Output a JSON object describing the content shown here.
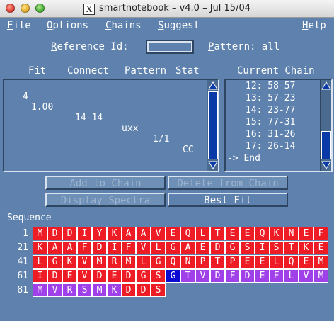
{
  "window": {
    "title": "smartnotebook – v4.0 – Jul 15/04",
    "x_glyph": "X"
  },
  "menus": [
    {
      "pre": "",
      "u": "F",
      "post": "ile"
    },
    {
      "pre": "",
      "u": "O",
      "post": "ptions"
    },
    {
      "pre": "",
      "u": "C",
      "post": "hains"
    },
    {
      "pre": "",
      "u": "S",
      "post": "uggest"
    },
    {
      "pre": "",
      "u": "H",
      "post": "elp"
    }
  ],
  "reference": {
    "label_u": "R",
    "label_rest": "eference Id:",
    "value": ""
  },
  "pattern": {
    "label_u": "P",
    "label_rest": "attern: all"
  },
  "fit_table": {
    "headers": [
      "Fit",
      "Connect",
      "Pattern",
      "Stat"
    ],
    "rows": [
      {
        "n": "4",
        "fit": "1.00",
        "connect": "14-14",
        "pattern": "uxx",
        "stat": "1/1",
        "extra": "CC"
      }
    ]
  },
  "chain": {
    "header": "Current Chain",
    "items": [
      "12: 58-57",
      "13: 57-23",
      "14: 23-77",
      "15: 77-31",
      "16: 31-26",
      "17: 26-14",
      "-> End"
    ]
  },
  "buttons": {
    "add_to_chain": "Add to Chain",
    "delete_from_chain": "Delete from Chain",
    "display_spectra": "Display Spectra",
    "best_fit": "Best Fit"
  },
  "sequence": {
    "label": "Sequence",
    "colors": {
      "red": "#ee1c24",
      "blue": "#0a0ad0",
      "purple": "#a040e8"
    },
    "rows": [
      {
        "start": "1",
        "residues": [
          "M",
          "D",
          "D",
          "I",
          "Y",
          "K",
          "A",
          "A",
          "V",
          "E",
          "Q",
          "L",
          "T",
          "E",
          "E",
          "Q",
          "K",
          "N",
          "E",
          "F"
        ],
        "colors": [
          "r",
          "r",
          "r",
          "r",
          "r",
          "r",
          "r",
          "r",
          "r",
          "r",
          "r",
          "r",
          "r",
          "r",
          "r",
          "r",
          "r",
          "r",
          "r",
          "r"
        ]
      },
      {
        "start": "21",
        "residues": [
          "K",
          "A",
          "A",
          "F",
          "D",
          "I",
          "F",
          "V",
          "L",
          "G",
          "A",
          "E",
          "D",
          "G",
          "S",
          "I",
          "S",
          "T",
          "K",
          "E"
        ],
        "colors": [
          "r",
          "r",
          "r",
          "r",
          "r",
          "r",
          "r",
          "r",
          "r",
          "r",
          "r",
          "r",
          "r",
          "r",
          "r",
          "r",
          "r",
          "r",
          "r",
          "r"
        ]
      },
      {
        "start": "41",
        "residues": [
          "L",
          "G",
          "K",
          "V",
          "M",
          "R",
          "M",
          "L",
          "G",
          "Q",
          "N",
          "P",
          "T",
          "P",
          "E",
          "E",
          "L",
          "Q",
          "E",
          "M"
        ],
        "colors": [
          "r",
          "r",
          "r",
          "r",
          "r",
          "r",
          "r",
          "r",
          "r",
          "r",
          "r",
          "r",
          "r",
          "r",
          "r",
          "r",
          "r",
          "r",
          "r",
          "r"
        ]
      },
      {
        "start": "61",
        "residues": [
          "I",
          "D",
          "E",
          "V",
          "D",
          "E",
          "D",
          "G",
          "S",
          "G",
          "T",
          "V",
          "D",
          "F",
          "D",
          "E",
          "F",
          "L",
          "V",
          "M"
        ],
        "colors": [
          "r",
          "r",
          "r",
          "r",
          "r",
          "r",
          "r",
          "r",
          "r",
          "b",
          "p",
          "p",
          "p",
          "p",
          "p",
          "p",
          "p",
          "p",
          "p",
          "p"
        ]
      },
      {
        "start": "81",
        "residues": [
          "M",
          "V",
          "R",
          "S",
          "M",
          "K",
          "D",
          "D",
          "S"
        ],
        "colors": [
          "p",
          "p",
          "p",
          "p",
          "p",
          "p",
          "r",
          "r",
          "r"
        ]
      }
    ]
  }
}
